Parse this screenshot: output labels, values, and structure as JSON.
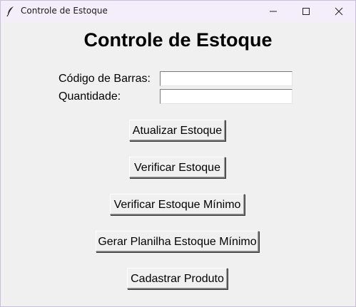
{
  "window": {
    "title": "Controle de Estoque",
    "icon": "feather-icon"
  },
  "main": {
    "heading": "Controle de Estoque",
    "barcode_label": "Código de Barras:",
    "barcode_value": "",
    "quantity_label": "Quantidade:",
    "quantity_value": ""
  },
  "buttons": {
    "update_stock": "Atualizar Estoque",
    "check_stock": "Verificar Estoque",
    "check_min_stock": "Verificar Estoque Mínimo",
    "generate_min_sheet": "Gerar Planilha Estoque Mínimo",
    "register_product": "Cadastrar Produto"
  }
}
